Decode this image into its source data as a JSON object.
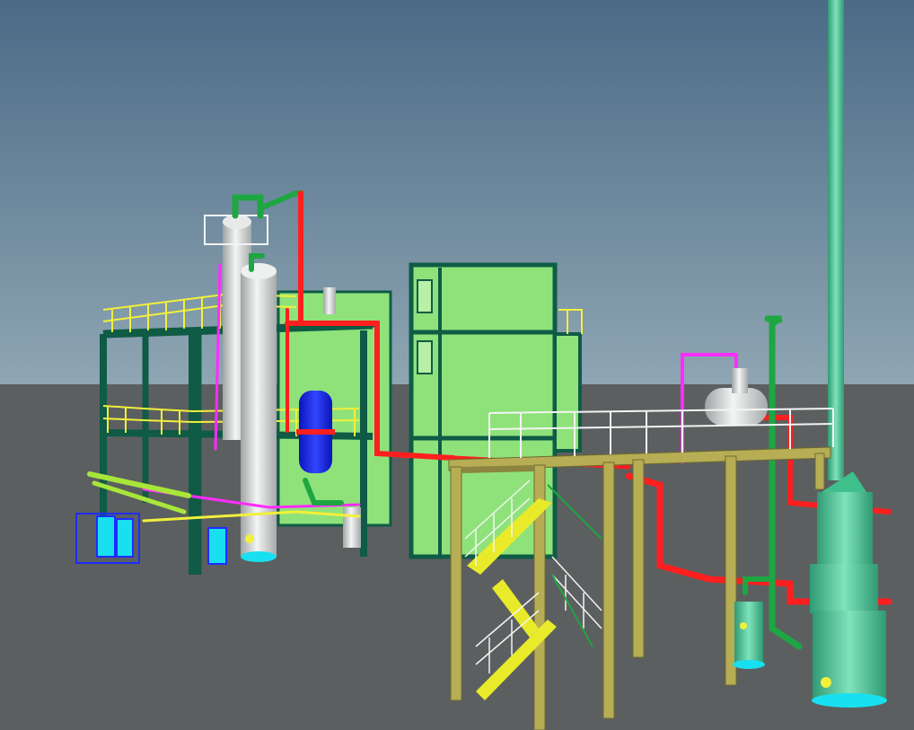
{
  "scene": {
    "subject": "3D plant model",
    "colors": {
      "sky_top": "#4a6a86",
      "sky_horizon": "#8fa6b3",
      "ground": "#5c5f60",
      "steel_frame": "#0f5b45",
      "handrail": "#f2f03a",
      "column_silver": "#d9dcdc",
      "building_green": "#8fe27a",
      "building_trim": "#0e5c46",
      "pipe_red": "#ff1f1f",
      "pipe_green": "#1ea642",
      "pipe_magenta": "#ff2cff",
      "pipe_blue_vessel": "#1d2cff",
      "trestle_khaki": "#b6ad55",
      "stair_yellow": "#e8ea2a",
      "scrubber_teal": "#5fcfa3",
      "stack_teal": "#3fbf8c",
      "cyan_accent": "#18e0f0",
      "white_rail": "#f4f4f4"
    }
  }
}
